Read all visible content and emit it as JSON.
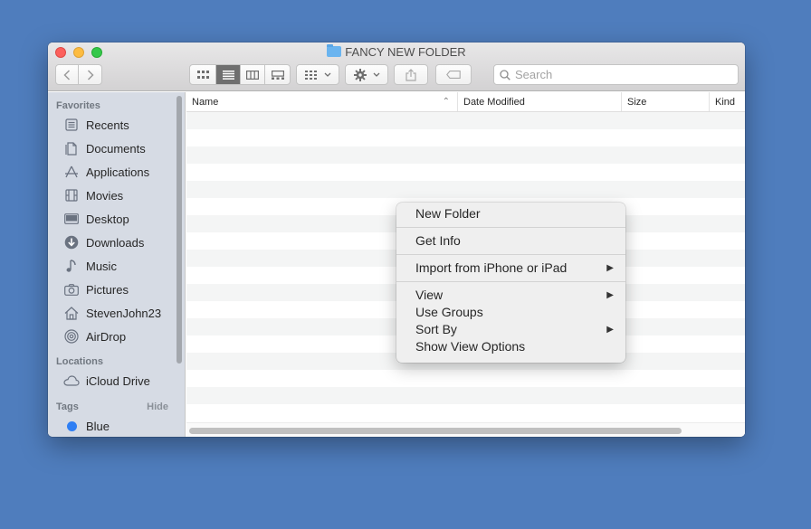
{
  "window": {
    "title": "FANCY NEW FOLDER"
  },
  "toolbar": {
    "search_placeholder": "Search",
    "view_modes": [
      "icon-view-icon",
      "list-view-icon",
      "column-view-icon",
      "gallery-view-icon"
    ],
    "active_view": "list"
  },
  "sidebar": {
    "favorites_header": "Favorites",
    "favorites": [
      {
        "label": "Recents",
        "icon": "recents-icon"
      },
      {
        "label": "Documents",
        "icon": "documents-icon"
      },
      {
        "label": "Applications",
        "icon": "applications-icon"
      },
      {
        "label": "Movies",
        "icon": "movies-icon"
      },
      {
        "label": "Desktop",
        "icon": "desktop-icon"
      },
      {
        "label": "Downloads",
        "icon": "downloads-icon"
      },
      {
        "label": "Music",
        "icon": "music-icon"
      },
      {
        "label": "Pictures",
        "icon": "pictures-icon"
      },
      {
        "label": "StevenJohn23",
        "icon": "home-icon"
      },
      {
        "label": "AirDrop",
        "icon": "airdrop-icon"
      }
    ],
    "locations_header": "Locations",
    "locations": [
      {
        "label": "iCloud Drive",
        "icon": "cloud-icon"
      }
    ],
    "tags_header": "Tags",
    "tags_hide": "Hide",
    "tags": [
      {
        "label": "Blue",
        "color": "#2f7ff4"
      }
    ]
  },
  "columns": {
    "name": "Name",
    "date_modified": "Date Modified",
    "size": "Size",
    "kind": "Kind"
  },
  "context_menu": {
    "new_folder": "New Folder",
    "get_info": "Get Info",
    "import": "Import from iPhone or iPad",
    "view": "View",
    "use_groups": "Use Groups",
    "sort_by": "Sort By",
    "show_view_options": "Show View Options"
  },
  "colors": {
    "desktop": "#4f7dbd",
    "sidebar": "#d6dbe4",
    "close": "#fc605c",
    "minimize": "#fdbc40",
    "maximize": "#34c84a"
  }
}
